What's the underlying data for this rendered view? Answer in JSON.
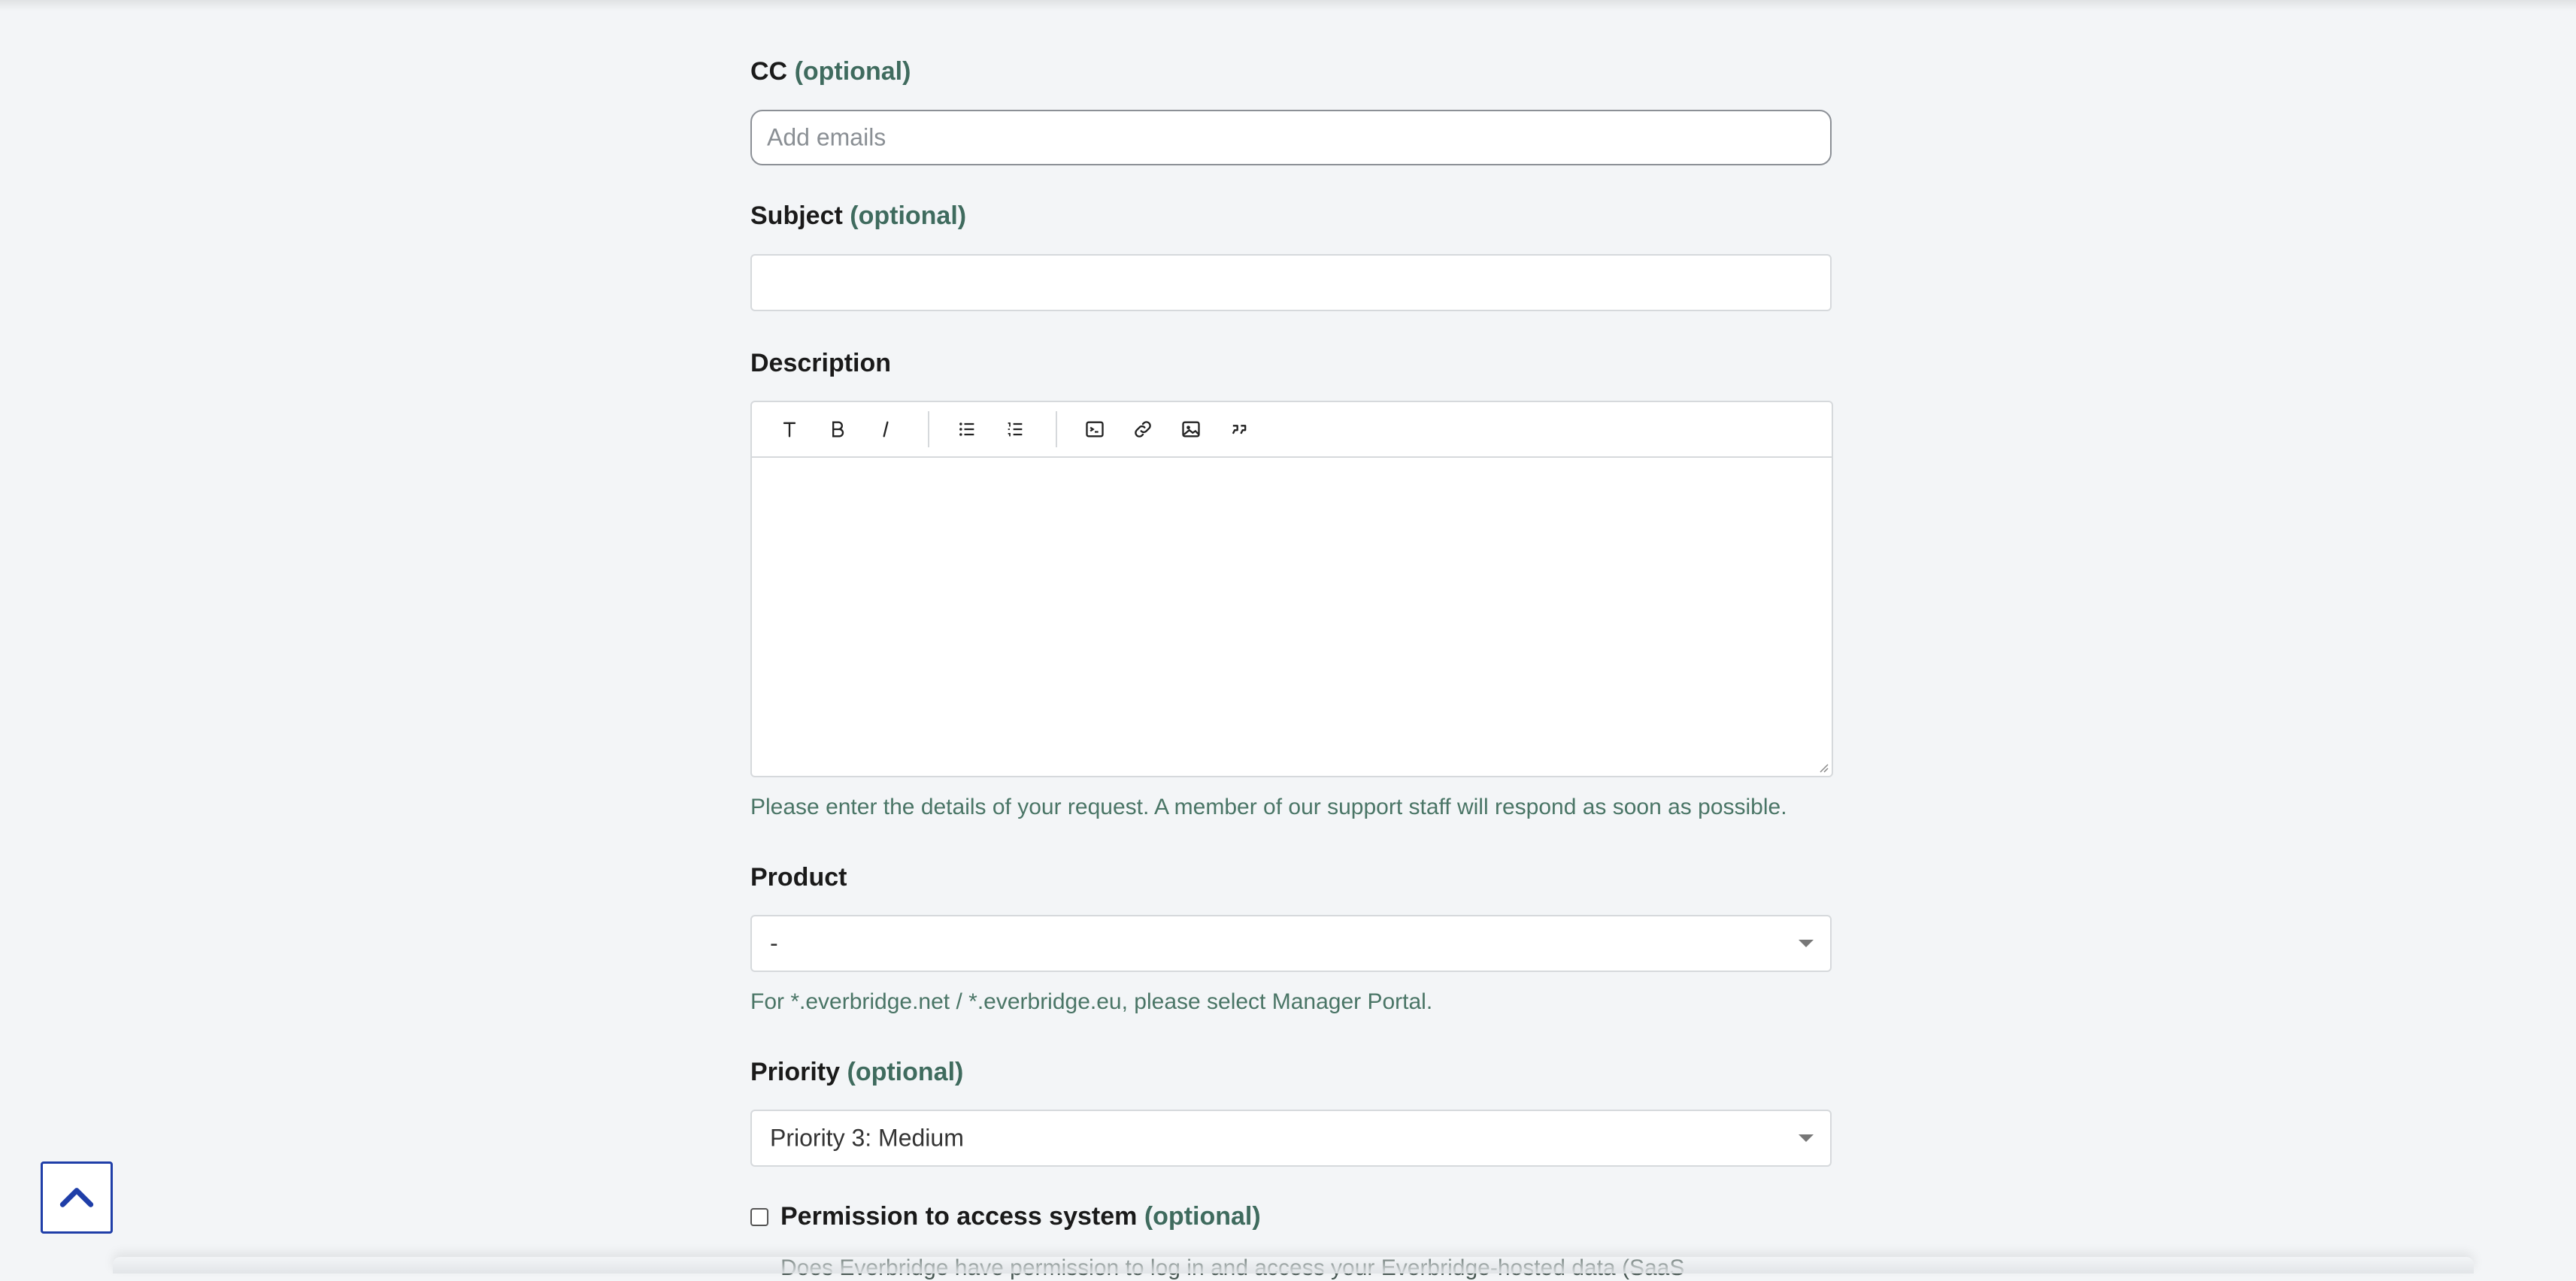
{
  "cc": {
    "label": "CC",
    "optional": "(optional)",
    "placeholder": "Add emails"
  },
  "subject": {
    "label": "Subject",
    "optional": "(optional)",
    "value": ""
  },
  "description": {
    "label": "Description",
    "toolbar": [
      "text-format-icon",
      "bold-icon",
      "italic-icon",
      "bullet-list-icon",
      "numbered-list-icon",
      "code-block-icon",
      "link-icon",
      "image-icon",
      "quote-icon"
    ],
    "hint": "Please enter the details of your request. A member of our support staff will respond as soon as possible."
  },
  "product": {
    "label": "Product",
    "selected": "-",
    "hint": "For *.everbridge.net / *.everbridge.eu, please select Manager Portal."
  },
  "priority": {
    "label": "Priority",
    "optional": "(optional)",
    "selected": "Priority 3: Medium"
  },
  "permission": {
    "label": "Permission to access system",
    "optional": "(optional)",
    "description": "Does Everbridge have permission to log in and access your Everbridge-hosted data (SaaS"
  },
  "colors": {
    "background": "#f3f5f7",
    "optional_text": "#3f6b5e",
    "hint_text": "#4a7566",
    "back_to_top": "#1f3ea8"
  },
  "back_to_top": {
    "icon": "chevron-up-icon"
  }
}
